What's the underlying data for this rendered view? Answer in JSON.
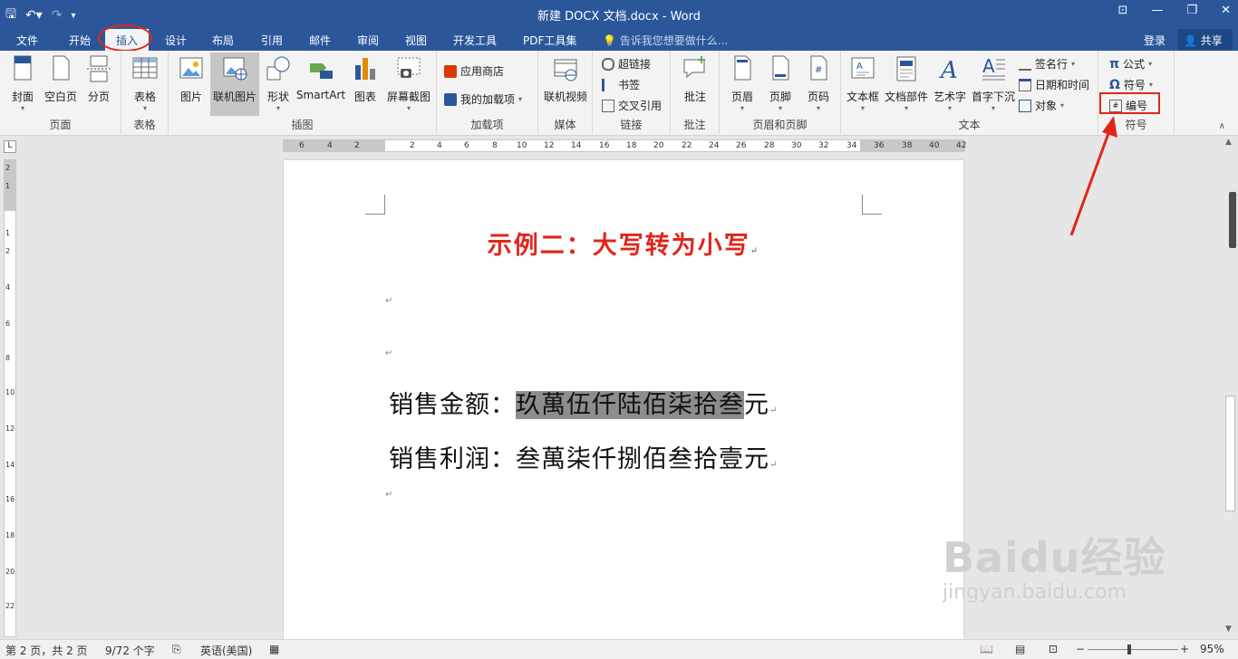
{
  "window": {
    "title": "新建 DOCX 文档.docx - Word"
  },
  "qat": {
    "save_icon": "save-icon",
    "undo_icon": "undo-icon",
    "redo_icon": "redo-icon"
  },
  "tabs": [
    "文件",
    "开始",
    "插入",
    "设计",
    "布局",
    "引用",
    "邮件",
    "审阅",
    "视图",
    "开发工具",
    "PDF工具集"
  ],
  "tell_me": "告诉我您想要做什么...",
  "account": {
    "login": "登录",
    "share": "共享"
  },
  "ribbon": {
    "groups": {
      "pages": "页面",
      "tables": "表格",
      "illustrations": "插图",
      "addins": "加载项",
      "media": "媒体",
      "links": "链接",
      "comments": "批注",
      "header_footer": "页眉和页脚",
      "text": "文本",
      "symbols": "符号"
    },
    "buttons": {
      "cover": "封面",
      "blank_page": "空白页",
      "page_break": "分页",
      "table": "表格",
      "picture": "图片",
      "online_picture": "联机图片",
      "shapes": "形状",
      "smartart": "SmartArt",
      "chart": "图表",
      "screenshot": "屏幕截图",
      "store": "应用商店",
      "my_addins": "我的加载项",
      "online_video": "联机视频",
      "hyperlink": "超链接",
      "bookmark": "书签",
      "cross_ref": "交叉引用",
      "comment": "批注",
      "header": "页眉",
      "footer": "页脚",
      "page_number": "页码",
      "text_box": "文本框",
      "quick_parts": "文档部件",
      "wordart": "艺术字",
      "drop_cap": "首字下沉",
      "signature_line": "签名行",
      "date_time": "日期和时间",
      "object": "对象",
      "equation": "公式",
      "symbol": "符号",
      "number": "编号"
    }
  },
  "ruler": {
    "h_ticks": [
      "6",
      "4",
      "2",
      "2",
      "4",
      "6",
      "8",
      "10",
      "12",
      "14",
      "16",
      "18",
      "20",
      "22",
      "24",
      "26",
      "28",
      "30",
      "32",
      "34",
      "36",
      "38",
      "40",
      "42"
    ],
    "v_ticks": [
      "2",
      "1",
      "1",
      "2",
      "4",
      "6",
      "8",
      "10",
      "12",
      "14",
      "16",
      "18",
      "20",
      "22"
    ]
  },
  "document": {
    "title": "示例二：大写转为小写",
    "line1_label": "销售金额：",
    "line1_selected": "玖萬伍仟陆佰柒拾叁",
    "line1_tail": "元",
    "line2_label": "销售利润：",
    "line2_value": "叁萬柒仟捌佰叁拾壹元",
    "para_mark": "↵"
  },
  "status": {
    "page": "第 2 页，共 2 页",
    "words": "9/72 个字",
    "language": "英语(美国)",
    "zoom": "95%"
  },
  "watermark": {
    "brand": "Baidu经验",
    "url": "jingyan.baidu.com"
  },
  "colors": {
    "accent": "#2b579a",
    "annotation": "#e0261b",
    "selection": "#8d8d8d"
  }
}
